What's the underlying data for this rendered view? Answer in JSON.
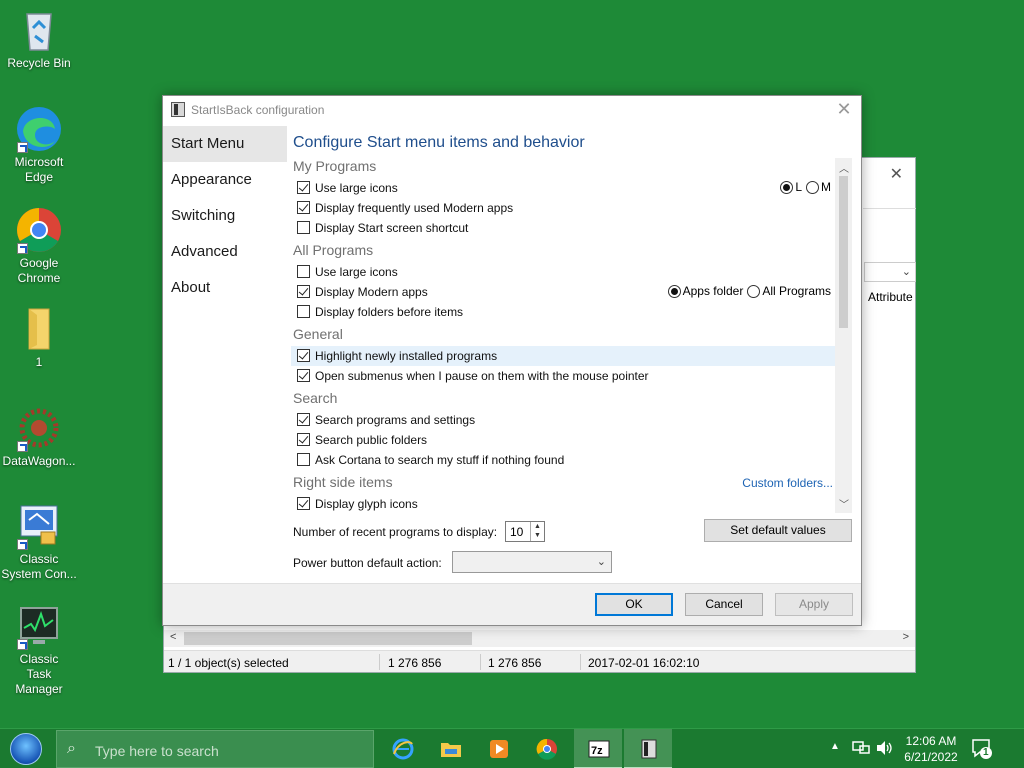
{
  "desktop": {
    "icons": [
      {
        "label": "Recycle Bin",
        "icon": "recycle-bin-icon"
      },
      {
        "label": "Microsoft Edge",
        "icon": "edge-icon"
      },
      {
        "label": "Google Chrome",
        "icon": "chrome-icon"
      },
      {
        "label": "1",
        "icon": "folder-icon"
      },
      {
        "label": "DataWagon...",
        "icon": "datawagon-icon"
      },
      {
        "label": "Classic System Con...",
        "icon": "control-panel-icon"
      },
      {
        "label": "Classic Task Manager",
        "icon": "task-manager-icon"
      }
    ]
  },
  "background_window": {
    "column_attr": "Attribute",
    "status": {
      "selected": "1 / 1 object(s) selected",
      "size1": "1 276 856",
      "size2": "1 276 856",
      "date": "2017-02-01 16:02:10"
    }
  },
  "dialog": {
    "title": "StartIsBack configuration",
    "nav": [
      "Start Menu",
      "Appearance",
      "Switching",
      "Advanced",
      "About"
    ],
    "active_nav": "Start Menu",
    "heading": "Configure Start menu items and behavior",
    "sections": {
      "my_programs": {
        "title": "My Programs",
        "items": [
          {
            "label": "Use large icons",
            "checked": true
          },
          {
            "label": "Display frequently used Modern apps",
            "checked": true
          },
          {
            "label": "Display Start screen shortcut",
            "checked": false
          }
        ],
        "icon_size": {
          "options": [
            "L",
            "M"
          ],
          "selected": "L"
        }
      },
      "all_programs": {
        "title": "All Programs",
        "items": [
          {
            "label": "Use large icons",
            "checked": false
          },
          {
            "label": "Display Modern apps",
            "checked": true
          },
          {
            "label": "Display folders before items",
            "checked": false
          }
        ],
        "modern_apps_location": {
          "options": [
            "Apps folder",
            "All Programs"
          ],
          "selected": "Apps folder"
        }
      },
      "general": {
        "title": "General",
        "items": [
          {
            "label": "Highlight newly installed programs",
            "checked": true
          },
          {
            "label": "Open submenus when I pause on them with the mouse pointer",
            "checked": true
          }
        ]
      },
      "search": {
        "title": "Search",
        "items": [
          {
            "label": "Search programs and settings",
            "checked": true
          },
          {
            "label": "Search public folders",
            "checked": true
          },
          {
            "label": "Ask Cortana to search my stuff if nothing found",
            "checked": false
          }
        ]
      },
      "right_side": {
        "title": "Right side items",
        "link": "Custom folders...",
        "items": [
          {
            "label": "Display glyph icons",
            "checked": true
          }
        ]
      }
    },
    "recent_label": "Number of recent programs to display:",
    "recent_value": "10",
    "set_default": "Set default values",
    "power_label": "Power button default action:",
    "power_value": "",
    "ok": "OK",
    "cancel": "Cancel",
    "apply": "Apply"
  },
  "taskbar": {
    "search_placeholder": "Type here to search",
    "apps": [
      "ie-icon",
      "file-explorer-icon",
      "media-player-icon",
      "chrome-icon",
      "7zip-icon",
      "startisback-icon"
    ],
    "time": "12:06 AM",
    "date": "6/21/2022",
    "notifications": "1"
  },
  "colors": {
    "desktop": "#1e8a37",
    "taskbar": "#1b7a30",
    "accent": "#0078d7",
    "heading": "#1f4e8c",
    "link": "#1e64b4"
  }
}
